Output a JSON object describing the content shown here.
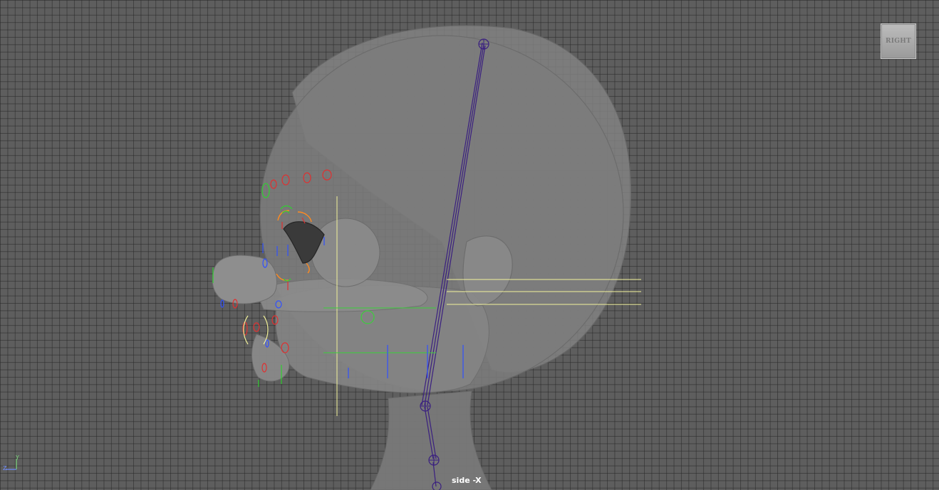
{
  "viewport": {
    "view_cube_label": "RIGHT",
    "camera_label": "side -X"
  },
  "axis_gizmo": {
    "y_label": "Y",
    "z_label": "Z"
  },
  "colors": {
    "grid_background": "#5e5e5e",
    "mesh": "#7c7c7c",
    "joint": "#4a2a8a",
    "control_red": "#e03030",
    "control_green": "#30d030",
    "control_blue": "#3050ff",
    "control_orange": "#ff8a20",
    "guide_yellow": "#f0f090"
  }
}
